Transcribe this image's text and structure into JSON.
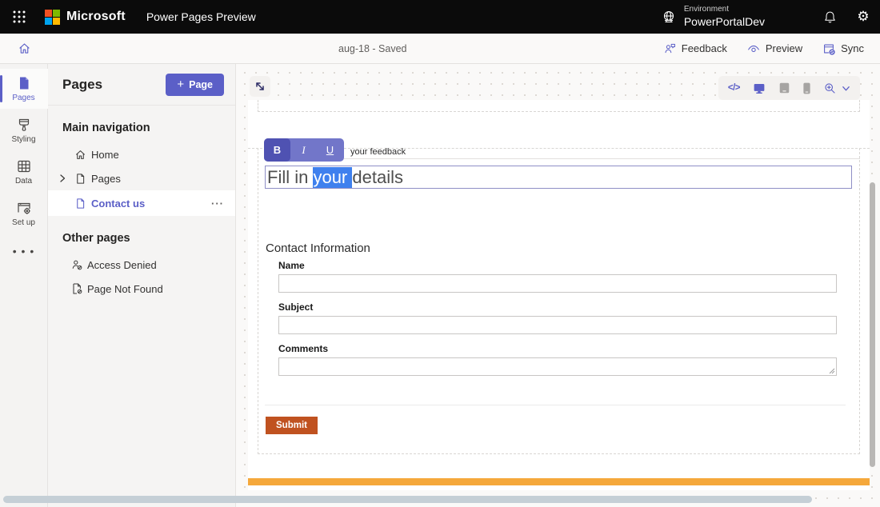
{
  "topbar": {
    "brand": "Microsoft",
    "app_name": "Power Pages Preview",
    "environment_label": "Environment",
    "environment_name": "PowerPortalDev"
  },
  "commandbar": {
    "save_status": "aug-18 - Saved",
    "feedback_label": "Feedback",
    "preview_label": "Preview",
    "sync_label": "Sync"
  },
  "rail": {
    "pages_label": "Pages",
    "styling_label": "Styling",
    "data_label": "Data",
    "setup_label": "Set up",
    "more_glyph": "• • •"
  },
  "sidebar": {
    "title": "Pages",
    "plus_glyph": "+",
    "add_page_label": "Page",
    "main_nav_heading": "Main navigation",
    "other_pages_heading": "Other pages",
    "items": {
      "home": "Home",
      "pages": "Pages",
      "contact": "Contact us",
      "access_denied": "Access Denied",
      "page_not_found": "Page Not Found"
    },
    "more_glyph": "···"
  },
  "canvas": {
    "code_glyph": "</>",
    "toolbar": {
      "bold": "B",
      "italic": "I",
      "underline": "U"
    },
    "hint_text": "your feedback",
    "heading_pre": "Fill in ",
    "heading_selected": "your ",
    "heading_post": "details",
    "form": {
      "title": "Contact Information",
      "name_label": "Name",
      "name_value": "",
      "subject_label": "Subject",
      "subject_value": "",
      "comments_label": "Comments",
      "comments_value": "",
      "submit_label": "Submit"
    }
  },
  "colors": {
    "accent_purple": "#5b5fc7",
    "toolbar_purple": "#7276c9",
    "bold_key_purple": "#4f52b2",
    "submit_orange": "#c05220",
    "footer_orange": "#f5a83b",
    "selection_blue": "#3f80ee"
  }
}
